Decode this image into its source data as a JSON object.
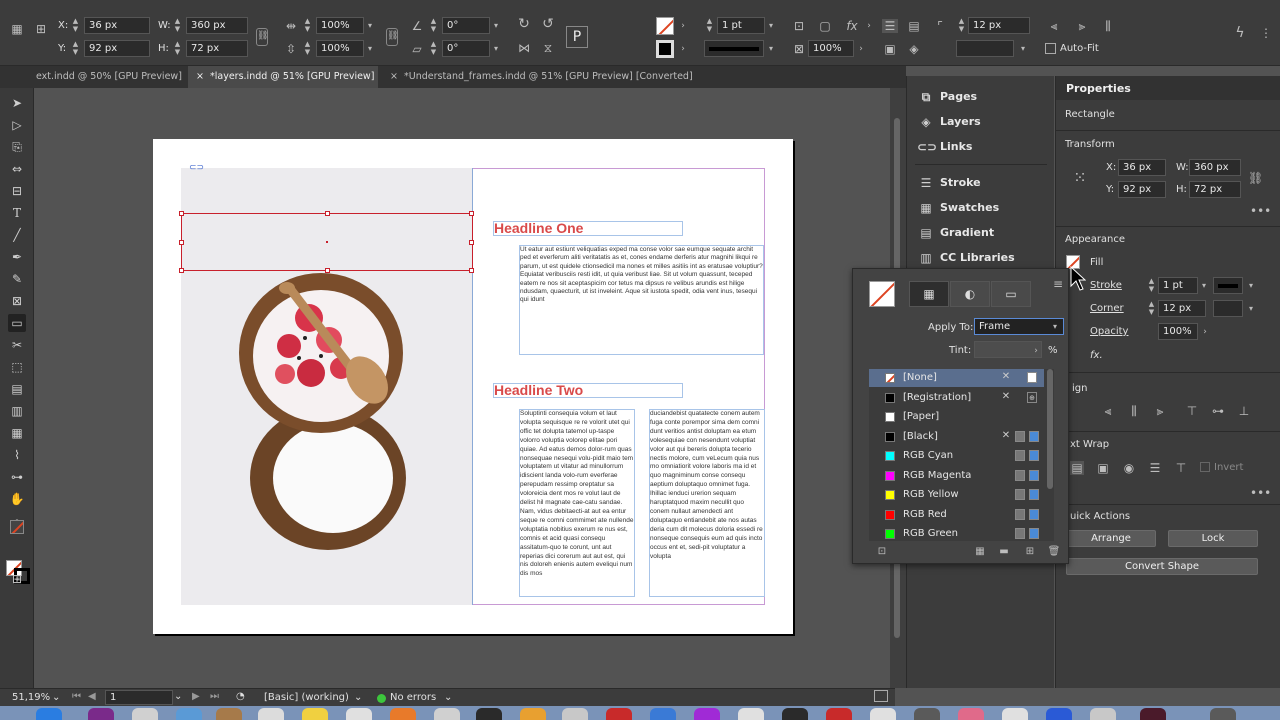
{
  "control_bar": {
    "x_label": "X:",
    "x_value": "36 px",
    "y_label": "Y:",
    "y_value": "92 px",
    "w_label": "W:",
    "w_value": "360 px",
    "h_label": "H:",
    "h_value": "72 px",
    "scale_x": "100%",
    "scale_y": "100%",
    "rotation": "0°",
    "shear": "0°",
    "stroke_weight": "1 pt",
    "opacity": "100%",
    "corner": "12 px",
    "autofit_label": "Auto-Fit"
  },
  "tabs": [
    {
      "label": "ext.indd @ 50% [GPU Preview]"
    },
    {
      "label": "*layers.indd @ 51% [GPU Preview]"
    },
    {
      "label": "*Understand_frames.indd @ 51% [GPU Preview] [Converted]"
    }
  ],
  "document": {
    "headline_one": "Headline One",
    "headline_two": "Headline Two",
    "body_one": "Ut eatur aut estiunt veliquatias exped ma conse volor sae eumque sequate archit ped et everferum aliti veritatatis as et, cones endame derferis atur magnihi likqui re parum, ut est quidele ctionsedicil ma nones et milles asitiis int as eratusae voluptiur? Equiatat veribusciis resti idit, ut quia veribust liae. Sit ut volum quassunt, teceped eatem re nos sit aceptaspicim cor tetus ma dipsus re velibus arundis est hilige ndusdam, quaecturit, ut ist inveleint. Aque sit iustota spedit, odia vent inus, tesequi qui idunt",
    "body_two_col1": "Soluptinti consequia volum et laut volupta sequisque re re volorit utet qui offic tet dolupta tatemol up-taspe volorro voluptia volorep elitae pori quiae. Ad eatus demos dolor-rum quas nonsequae nesequi volu-pidit maio tem voluptatem ut vitatur ad minullorrum idiscient landa volo-rum everferae perepudam ressimp oreptatur sa voloreicia dent mos re volut laut de delist hil magnate cae-catu sandae. Nam, vidus debitaecti-at aut ea entur seque re comni commimet ate nullende voluptatia nobitius exerum re nus est, comnis et acid quasi consequ assitatum-quo te corunt, unt aut reperias dici corerum aut aut est, qui nis doloreh enienis autem eveliqui num dis mos",
    "body_two_col2": "duciandebist quatatecte conem autem fuga conte porempor sima dem comni dunt veritios antist doluptam ea etum volesequiae con nesendunt voluptiat volor aut qui bereris dolupta tecerio nectis molore, cum veLecum quia nus mo omniatiorit volore laboris ma id et quo magniminum conse consequ aeptium doluptaquo omnimet fuga. Ihillac ienduci urerion sequam haruptatquod maxim necullit quo conem nullaut amendecti ant doluptaquo entiandebit ate nos autas deria cum dit molecus doloria essedi re nonseque consequis eum ad quis incto occus ent et, sedi-pit voluptatur a volupta"
  },
  "panel_strip": {
    "items": [
      {
        "label": "Pages",
        "icon": "pages-icon"
      },
      {
        "label": "Layers",
        "icon": "layers-icon"
      },
      {
        "label": "Links",
        "icon": "links-icon"
      },
      {
        "label": "Stroke",
        "icon": "stroke-icon"
      },
      {
        "label": "Swatches",
        "icon": "swatches-icon"
      },
      {
        "label": "Gradient",
        "icon": "gradient-icon"
      },
      {
        "label": "CC Libraries",
        "icon": "cc-libraries-icon"
      }
    ]
  },
  "properties": {
    "title": "Properties",
    "object_type": "Rectangle",
    "transform_label": "Transform",
    "x_label": "X:",
    "x_value": "36 px",
    "y_label": "Y:",
    "y_value": "92 px",
    "w_label": "W:",
    "w_value": "360 px",
    "h_label": "H:",
    "h_value": "72 px",
    "appearance_label": "Appearance",
    "fill_label": "Fill",
    "stroke_label": "Stroke",
    "stroke_value": "1 pt",
    "corner_label": "Corner",
    "corner_value": "12 px",
    "opacity_label": "Opacity",
    "opacity_value": "100%",
    "fx_label": "fx.",
    "align_label": "ign",
    "text_wrap_label": "xt Wrap",
    "invert_label": "Invert",
    "quick_actions_label": "uick Actions",
    "arrange_label": "Arrange",
    "lock_label": "Lock",
    "convert_shape_label": "Convert Shape"
  },
  "swatches_popup": {
    "apply_to_label": "Apply To:",
    "apply_to_value": "Frame",
    "tint_label": "Tint:",
    "tint_unit": "%",
    "swatches": [
      {
        "name": "[None]",
        "color": "none",
        "selected": true
      },
      {
        "name": "[Registration]",
        "color": "#000000",
        "selected": false
      },
      {
        "name": "[Paper]",
        "color": "#ffffff",
        "selected": false
      },
      {
        "name": "[Black]",
        "color": "#000000",
        "selected": false
      },
      {
        "name": "RGB Cyan",
        "color": "#00ffff",
        "selected": false
      },
      {
        "name": "RGB Magenta",
        "color": "#ff00ff",
        "selected": false
      },
      {
        "name": "RGB Yellow",
        "color": "#ffff00",
        "selected": false
      },
      {
        "name": "RGB Red",
        "color": "#ff0000",
        "selected": false
      },
      {
        "name": "RGB Green",
        "color": "#00ff00",
        "selected": false
      }
    ]
  },
  "status_bar": {
    "zoom": "51,19%",
    "page": "1",
    "profile": "[Basic] (working)",
    "preflight": "No errors"
  },
  "colors": {
    "headline": "#d94a4a",
    "selection": "#c8202c",
    "accent_blue": "#5a6e8e"
  }
}
